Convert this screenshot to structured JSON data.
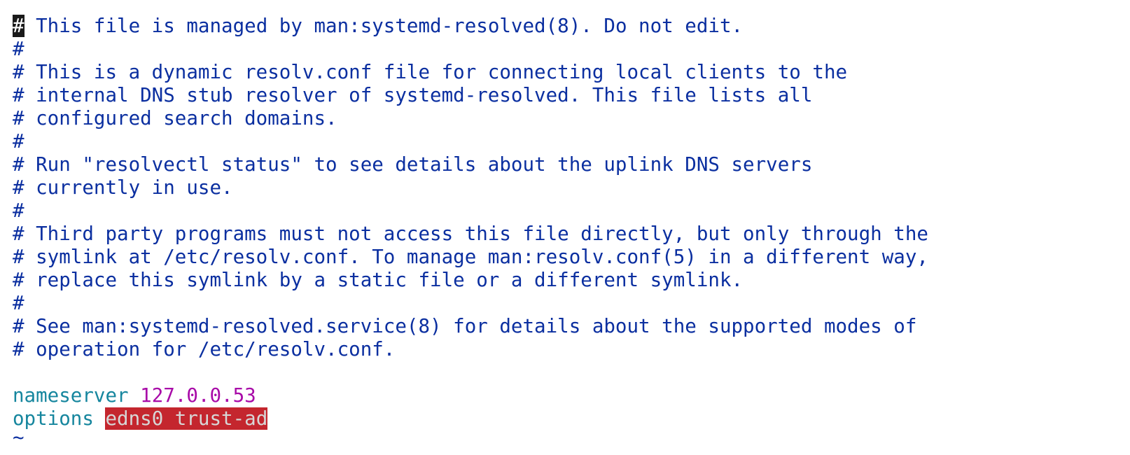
{
  "file": {
    "cursor_char": "#",
    "first_line_rest": " This file is managed by man:systemd-resolved(8). Do not edit.",
    "comment_lines": [
      "#",
      "# This is a dynamic resolv.conf file for connecting local clients to the",
      "# internal DNS stub resolver of systemd-resolved. This file lists all",
      "# configured search domains.",
      "#",
      "# Run \"resolvectl status\" to see details about the uplink DNS servers",
      "# currently in use.",
      "#",
      "# Third party programs must not access this file directly, but only through the",
      "# symlink at /etc/resolv.conf. To manage man:resolv.conf(5) in a different way,",
      "# replace this symlink by a static file or a different symlink.",
      "#",
      "# See man:systemd-resolved.service(8) for details about the supported modes of",
      "# operation for /etc/resolv.conf."
    ],
    "nameserver_keyword": "nameserver",
    "nameserver_value": "127.0.0.53",
    "options_keyword": "options",
    "options_value": "edns0 trust-ad",
    "tilde": "~"
  },
  "colors": {
    "comment": "#0b2fa0",
    "keyword": "#16869e",
    "value": "#a80aa8",
    "error_bg": "#c4262e"
  }
}
